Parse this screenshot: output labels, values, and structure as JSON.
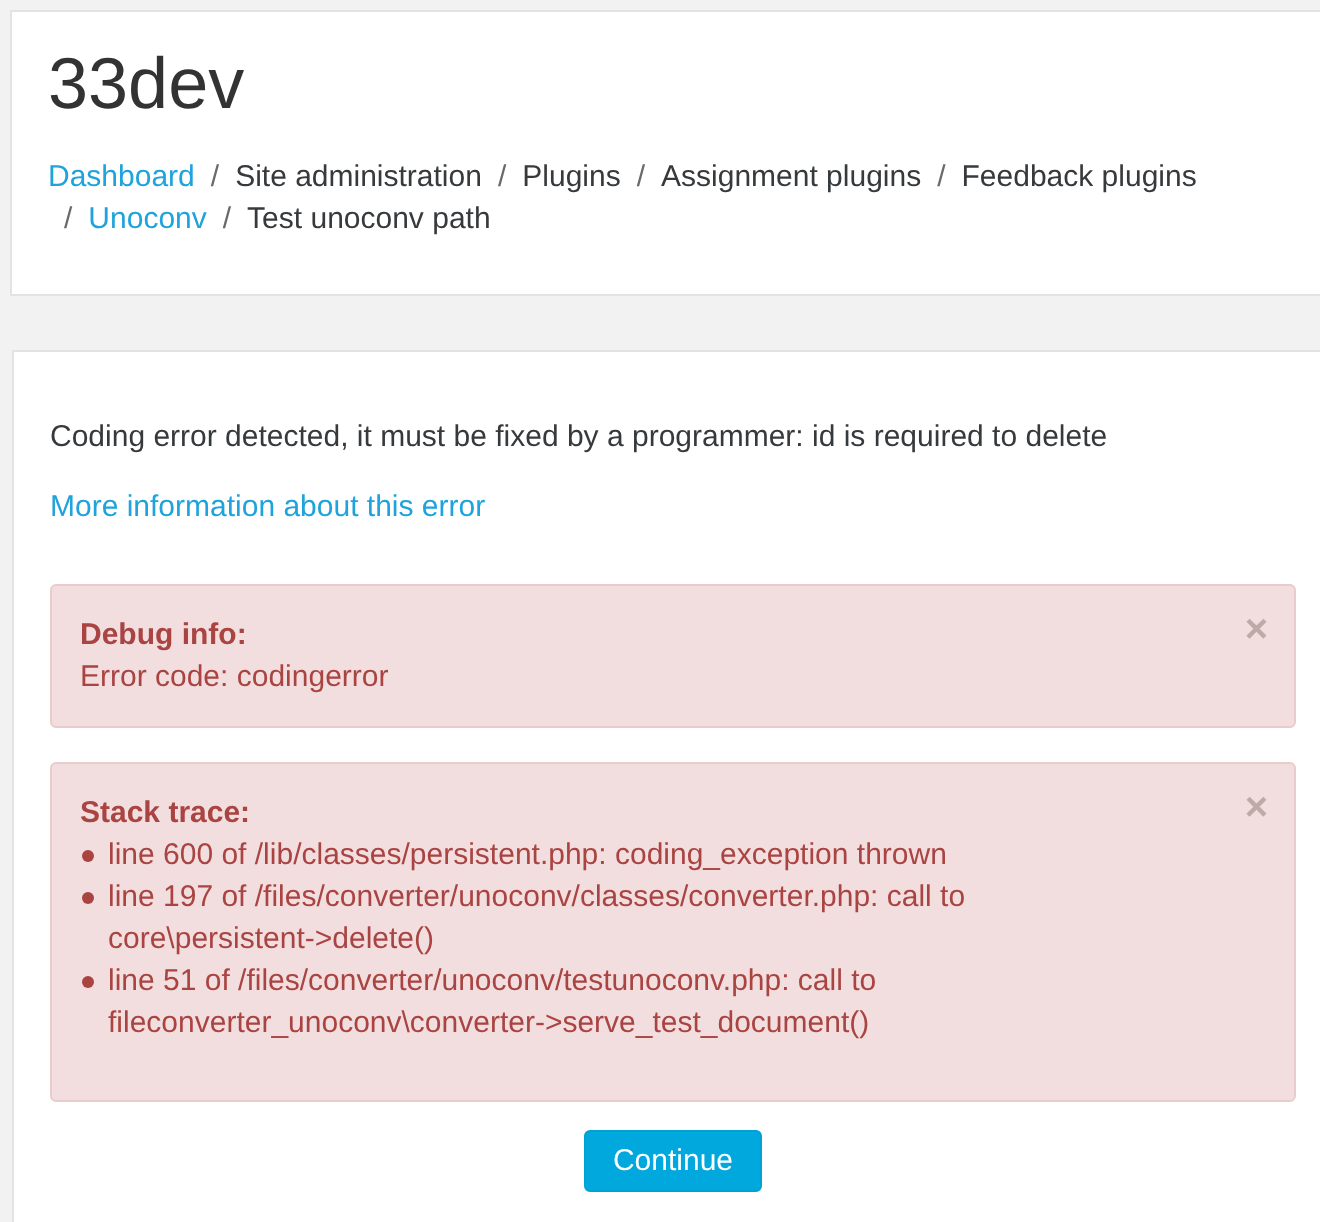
{
  "site": {
    "title": "33dev"
  },
  "breadcrumb": [
    {
      "label": "Dashboard",
      "link": true
    },
    {
      "separator": "/",
      "label": "Site administration",
      "link": false
    },
    {
      "separator": "/",
      "label": "Plugins",
      "link": false
    },
    {
      "separator": "/",
      "label": "Assignment plugins",
      "link": false
    },
    {
      "separator": "/",
      "label": "Feedback plugins",
      "link": false
    },
    {
      "separator": "/",
      "label": "Unoconv",
      "link": true
    },
    {
      "separator": "/",
      "label": "Test unoconv path",
      "link": false
    }
  ],
  "error": {
    "message": "Coding error detected, it must be fixed by a programmer: id is required to delete",
    "more_info_link": "More information about this error"
  },
  "alerts": [
    {
      "kind": "text",
      "title": "Debug info:",
      "lines": [
        "Error code: codingerror"
      ],
      "close": "×"
    },
    {
      "kind": "list",
      "title": "Stack trace:",
      "items": [
        "line 600 of /lib/classes/persistent.php: coding_exception thrown",
        "line 197 of /files/converter/unoconv/classes/converter.php: call to core\\persistent->delete()",
        "line 51 of /files/converter/unoconv/testunoconv.php: call to fileconverter_unoconv\\converter->serve_test_document()"
      ],
      "close": "×"
    }
  ],
  "continue_button": "Continue"
}
